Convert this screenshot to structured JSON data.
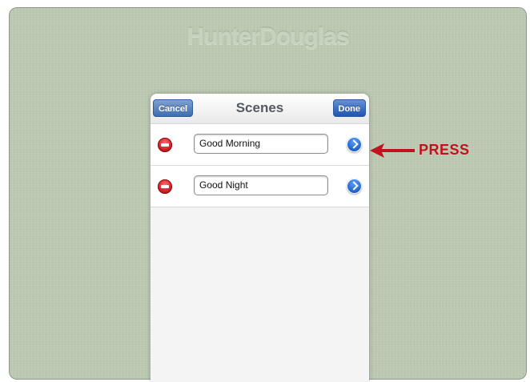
{
  "background": {
    "brand": "HunterDouglas",
    "color": "#bccab2"
  },
  "panel": {
    "title": "Scenes",
    "cancel_label": "Cancel",
    "done_label": "Done",
    "accent": "#3f6eb0"
  },
  "scenes": [
    {
      "name": "Good Morning",
      "delete_icon": "remove-icon",
      "detail_icon": "disclosure-icon"
    },
    {
      "name": "Good Night",
      "delete_icon": "remove-icon",
      "detail_icon": "disclosure-icon"
    }
  ],
  "annotation": {
    "label": "PRESS",
    "color": "#c1121f"
  }
}
